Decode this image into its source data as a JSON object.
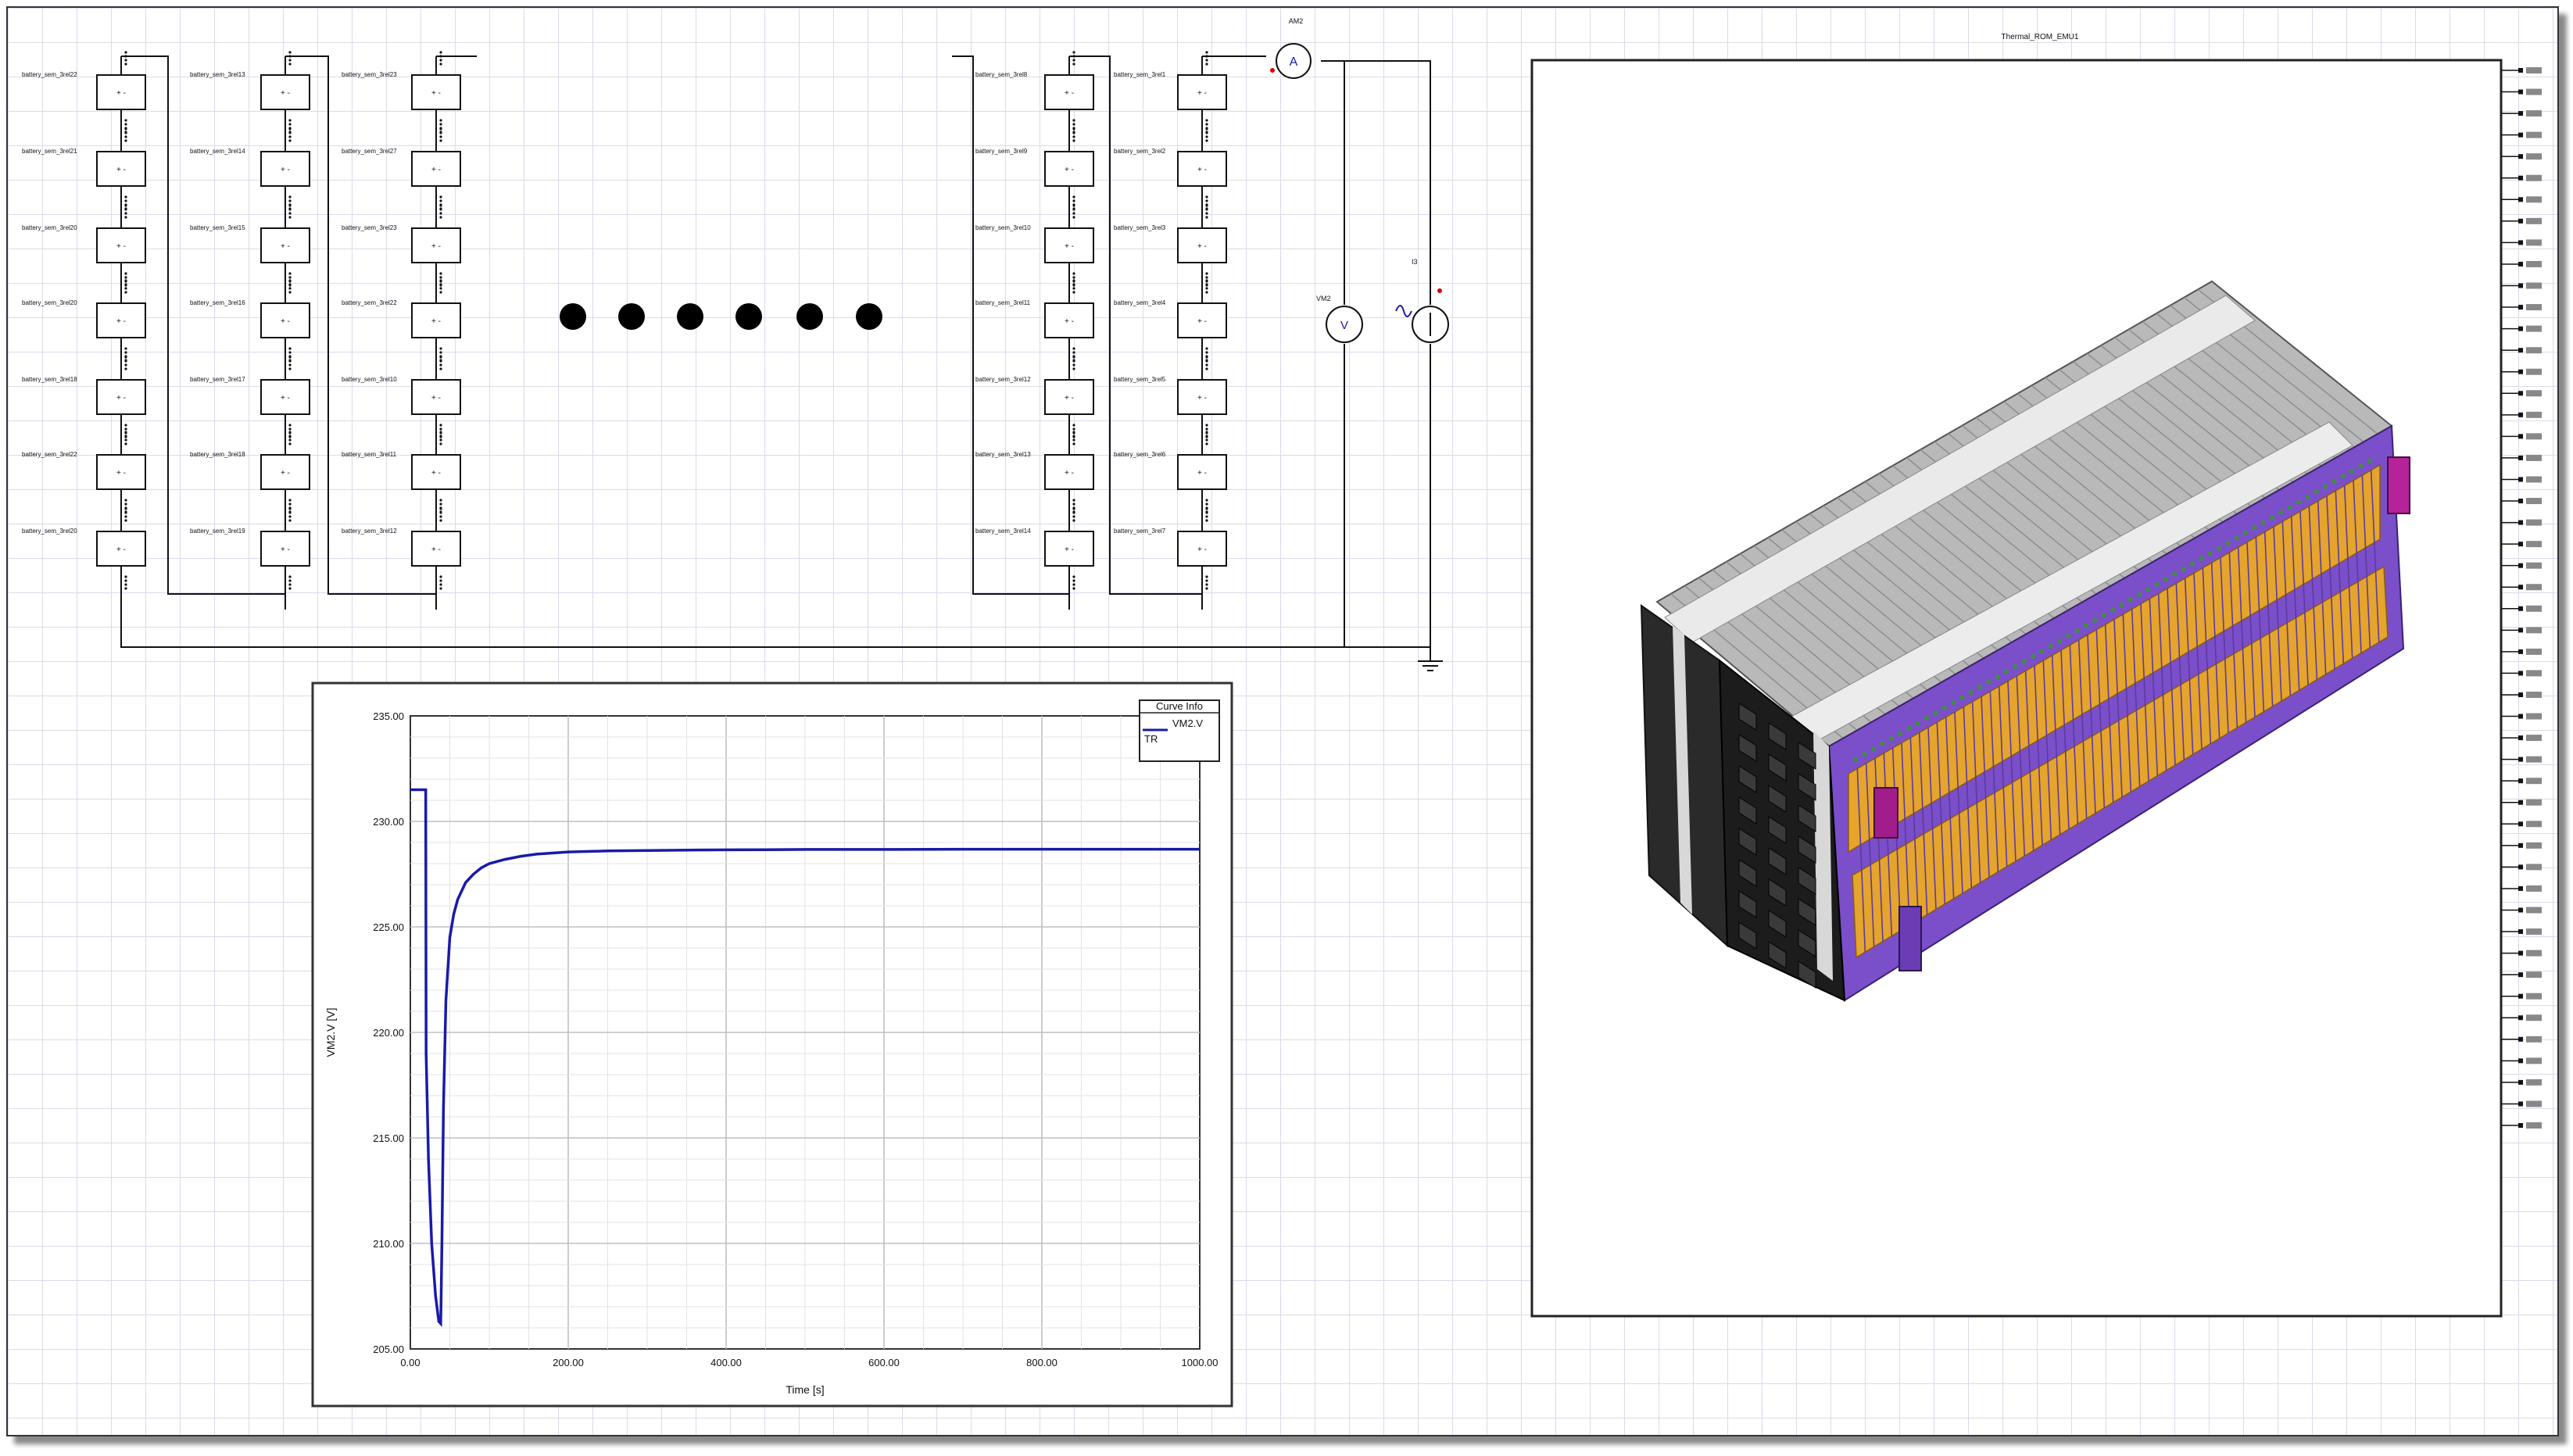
{
  "schematic": {
    "cell_labels": {
      "col1": [
        "battery_sem_3rel22",
        "battery_sem_3rel21",
        "battery_sem_3rel20",
        "battery_sem_3rel20",
        "battery_sem_3rel18",
        "battery_sem_3rel22",
        "battery_sem_3rel20"
      ],
      "col2": [
        "battery_sem_3rel13",
        "battery_sem_3rel14",
        "battery_sem_3rel15",
        "battery_sem_3rel16",
        "battery_sem_3rel17",
        "battery_sem_3rel18",
        "battery_sem_3rel19"
      ],
      "col3": [
        "battery_sem_3rel23",
        "battery_sem_3rel27",
        "battery_sem_3rel23",
        "battery_sem_3rel22",
        "battery_sem_3rel10",
        "battery_sem_3rel11",
        "battery_sem_3rel12"
      ],
      "col4": [
        "battery_sem_3rel8",
        "battery_sem_3rel9",
        "battery_sem_3rel10",
        "battery_sem_3rel11",
        "battery_sem_3rel12",
        "battery_sem_3rel13",
        "battery_sem_3rel14"
      ],
      "col5": [
        "battery_sem_3rel1",
        "battery_sem_3rel2",
        "battery_sem_3rel3",
        "battery_sem_3rel4",
        "battery_sem_3rel5",
        "battery_sem_3rel6",
        "battery_sem_3rel7"
      ]
    },
    "ammeter_label": "AM2",
    "voltmeter_label": "VM2",
    "source_label": "I3"
  },
  "chart_data": {
    "type": "line",
    "legend_title": "Curve Info",
    "legend_entry": "VM2.V",
    "legend_sub": "TR",
    "xlabel": "Time [s]",
    "ylabel": "VM2.V [V]",
    "xlim": [
      0,
      1000
    ],
    "ylim": [
      205,
      235
    ],
    "x_ticks": [
      "0.00",
      "200.00",
      "400.00",
      "600.00",
      "800.00",
      "1000.00"
    ],
    "y_ticks": [
      "235.00",
      "230.00",
      "225.00",
      "220.00",
      "215.00",
      "210.00",
      "205.00"
    ],
    "line_color": "#1a1aa8",
    "series": [
      {
        "x": [
          0,
          19.5,
          20,
          23,
          27,
          32,
          36,
          38.5,
          40,
          42,
          45,
          50,
          55,
          60,
          70,
          80,
          90,
          100,
          120,
          140,
          160,
          180,
          200,
          250,
          300,
          350,
          400,
          450,
          500,
          600,
          700,
          800,
          900,
          1000
        ],
        "y": [
          231.5,
          231.5,
          219,
          214,
          210,
          207.5,
          206.3,
          206.2,
          210,
          216.5,
          221.5,
          224.5,
          225.6,
          226.3,
          227.1,
          227.5,
          227.8,
          228.0,
          228.2,
          228.35,
          228.45,
          228.5,
          228.55,
          228.6,
          228.62,
          228.64,
          228.65,
          228.66,
          228.67,
          228.67,
          228.68,
          228.68,
          228.68,
          228.68
        ]
      }
    ]
  },
  "model": {
    "title": "Thermal_ROM_EMU1",
    "port_count": 50
  }
}
